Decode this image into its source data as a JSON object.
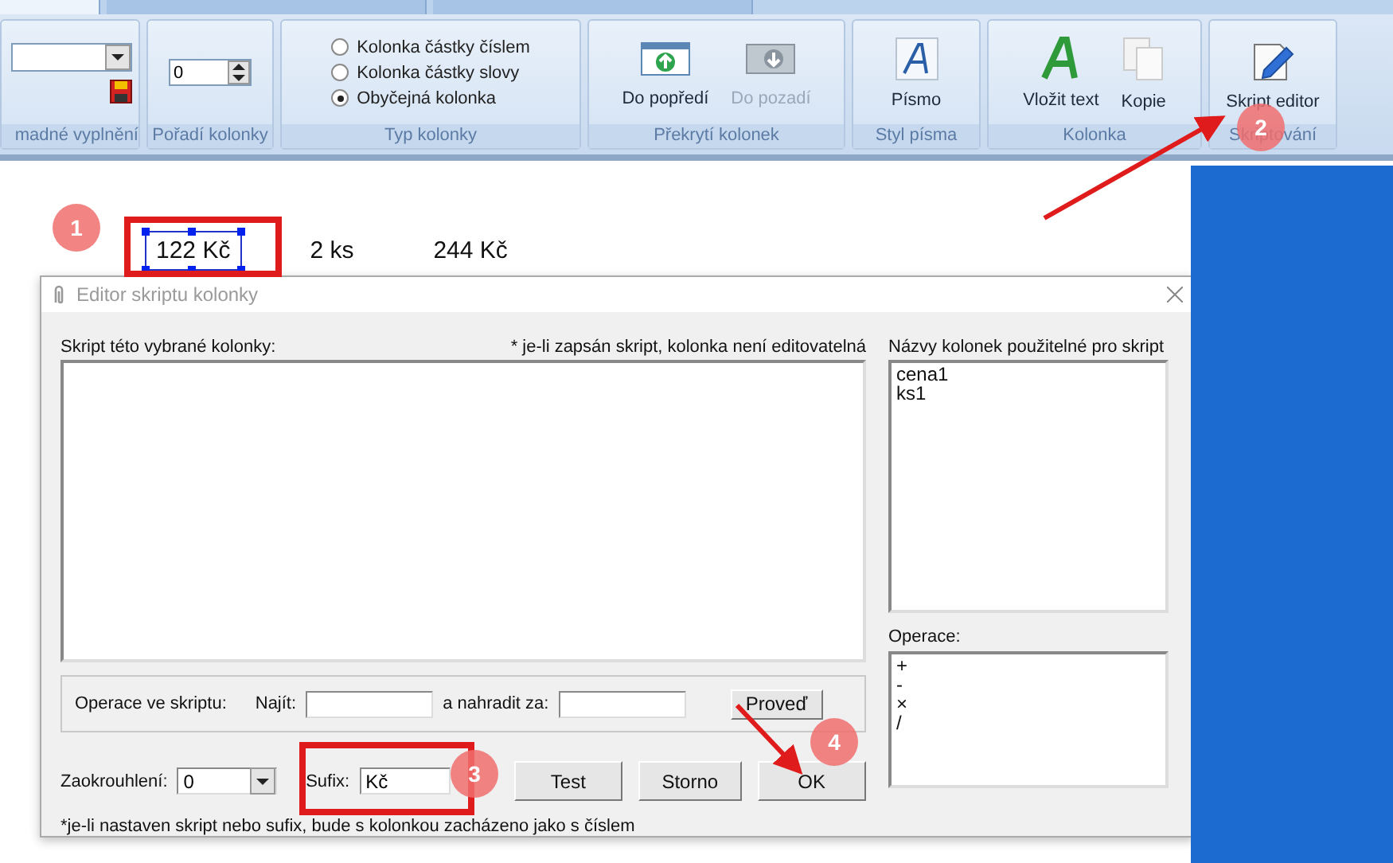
{
  "ribbon": {
    "tabs": [
      {
        "selected": true
      },
      {
        "selected": false
      },
      {
        "selected": false
      }
    ],
    "groups": [
      {
        "kind": "combo",
        "label": "madné vyplnění"
      },
      {
        "kind": "spinner",
        "label": "Pořadí kolonky",
        "value": "0"
      },
      {
        "kind": "radios",
        "label": "Typ kolonky",
        "options": [
          {
            "label": "Kolonka částky číslem",
            "selected": false
          },
          {
            "label": "Kolonka částky slovy",
            "selected": false
          },
          {
            "label": "Obyčejná kolonka",
            "selected": true
          }
        ]
      },
      {
        "kind": "buttons",
        "label": "Překrytí kolonek",
        "buttons": [
          {
            "label": "Do popředí",
            "disabled": false
          },
          {
            "label": "Do pozadí",
            "disabled": true
          }
        ]
      },
      {
        "kind": "buttons",
        "label": "Styl písma",
        "buttons": [
          {
            "label": "Písmo",
            "disabled": false
          }
        ]
      },
      {
        "kind": "buttons",
        "label": "Kolonka",
        "buttons": [
          {
            "label": "Vložit text",
            "disabled": false
          },
          {
            "label": "Kopie",
            "disabled": false
          }
        ]
      },
      {
        "kind": "buttons",
        "label": "Skriptování",
        "buttons": [
          {
            "label": "Skript editor",
            "disabled": false
          }
        ]
      }
    ]
  },
  "canvas": {
    "fields": [
      {
        "text": "122 Kč",
        "selected": true
      },
      {
        "text": "2 ks",
        "selected": false
      },
      {
        "text": "244 Kč",
        "selected": false
      }
    ]
  },
  "dialog": {
    "title": "Editor skriptu kolonky",
    "script_label": "Skript této vybrané kolonky:",
    "script_note": "* je-li zapsán skript, kolonka není editovatelná",
    "operations_group": {
      "label": "Operace ve skriptu:",
      "find_label": "Najít:",
      "replace_label": "a nahradit za:",
      "apply_button": "Proveď"
    },
    "rounding": {
      "label": "Zaokrouhlení:",
      "value": "0"
    },
    "suffix": {
      "label": "Sufix:",
      "value": "Kč"
    },
    "buttons": [
      "Test",
      "Storno",
      "OK"
    ],
    "footnote": "*je-li nastaven skript nebo sufix, bude s kolonkou zacházeno jako s číslem",
    "columns_label": "Názvy kolonek použitelné pro skript",
    "columns": [
      "cena1",
      "ks1"
    ],
    "operators_label": "Operace:",
    "operators": [
      "+",
      "-",
      "×",
      "/"
    ]
  },
  "annotations": [
    {
      "label": "1"
    },
    {
      "label": "2"
    },
    {
      "label": "3"
    },
    {
      "label": "4"
    }
  ]
}
